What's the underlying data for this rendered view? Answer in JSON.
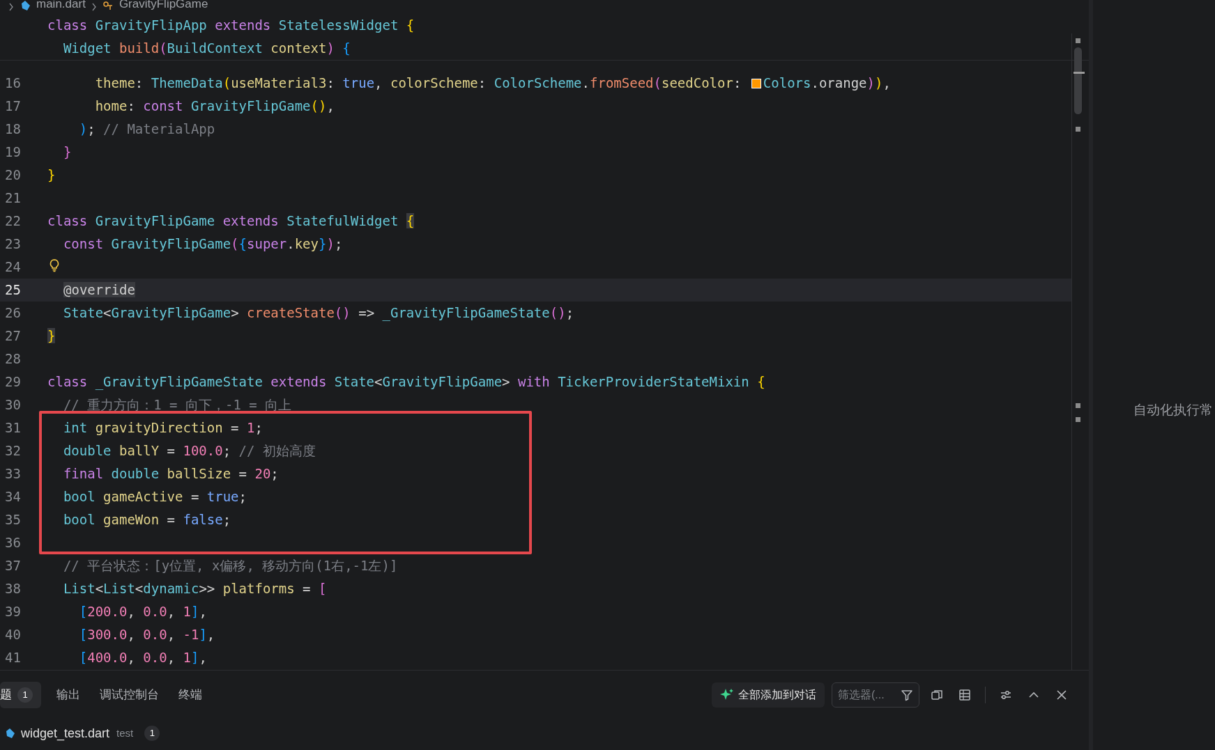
{
  "breadcrumb": [
    {
      "kind": "file",
      "label": "main.dart"
    },
    {
      "kind": "class",
      "label": "GravityFlipGame"
    }
  ],
  "sticky_lines": [
    {
      "tokens": [
        {
          "kind": "kw",
          "text": "class "
        },
        {
          "kind": "cls",
          "text": "GravityFlipApp "
        },
        {
          "kind": "kw",
          "text": "extends "
        },
        {
          "kind": "cls",
          "text": "StatelessWidget "
        },
        {
          "kind": "b1",
          "text": "{"
        }
      ]
    },
    {
      "tokens": [
        {
          "kind": "cls",
          "text": "  Widget "
        },
        {
          "kind": "fn",
          "text": "build"
        },
        {
          "kind": "b2",
          "text": "("
        },
        {
          "kind": "cls",
          "text": "BuildContext "
        },
        {
          "kind": "prop",
          "text": "context"
        },
        {
          "kind": "b2",
          "text": ") "
        },
        {
          "kind": "b3",
          "text": "{"
        }
      ]
    }
  ],
  "lines": [
    {
      "number": "16",
      "tokens": [
        {
          "kind": "prop",
          "text": "      theme"
        },
        {
          "kind": "pl",
          "text": ": "
        },
        {
          "kind": "cls",
          "text": "ThemeData"
        },
        {
          "kind": "b1",
          "text": "("
        },
        {
          "kind": "prop",
          "text": "useMaterial3"
        },
        {
          "kind": "pl",
          "text": ": "
        },
        {
          "kind": "lit",
          "text": "true"
        },
        {
          "kind": "pl",
          "text": ", "
        },
        {
          "kind": "prop",
          "text": "colorScheme"
        },
        {
          "kind": "pl",
          "text": ": "
        },
        {
          "kind": "cls",
          "text": "ColorScheme"
        },
        {
          "kind": "pl",
          "text": "."
        },
        {
          "kind": "fn",
          "text": "fromSeed"
        },
        {
          "kind": "b2",
          "text": "("
        },
        {
          "kind": "prop",
          "text": "seedColor"
        },
        {
          "kind": "pl",
          "text": ": "
        },
        {
          "kind": "swatch",
          "color": "#ff9800"
        },
        {
          "kind": "cls",
          "text": "Colors"
        },
        {
          "kind": "pl",
          "text": ".orange"
        },
        {
          "kind": "b2",
          "text": ")"
        },
        {
          "kind": "b1",
          "text": ")"
        },
        {
          "kind": "pl",
          "text": ","
        }
      ]
    },
    {
      "number": "17",
      "tokens": [
        {
          "kind": "prop",
          "text": "      home"
        },
        {
          "kind": "pl",
          "text": ": "
        },
        {
          "kind": "kw",
          "text": "const "
        },
        {
          "kind": "cls",
          "text": "GravityFlipGame"
        },
        {
          "kind": "b1",
          "text": "()"
        },
        {
          "kind": "pl",
          "text": ","
        }
      ]
    },
    {
      "number": "18",
      "tokens": [
        {
          "kind": "b3",
          "text": "    )"
        },
        {
          "kind": "pl",
          "text": "; "
        },
        {
          "kind": "cm",
          "text": "// MaterialApp"
        }
      ]
    },
    {
      "number": "19",
      "tokens": [
        {
          "kind": "b2",
          "text": "  }"
        }
      ]
    },
    {
      "number": "20",
      "tokens": [
        {
          "kind": "b1",
          "text": "}"
        }
      ]
    },
    {
      "number": "21"
    },
    {
      "number": "22",
      "tokens": [
        {
          "kind": "kw",
          "text": "class "
        },
        {
          "kind": "cls",
          "text": "GravityFlipGame "
        },
        {
          "kind": "kw",
          "text": "extends "
        },
        {
          "kind": "cls",
          "text": "StatefulWidget "
        },
        {
          "kind": "b1",
          "text": "{",
          "highlight": true
        }
      ]
    },
    {
      "number": "23",
      "tokens": [
        {
          "kind": "kw",
          "text": "  const "
        },
        {
          "kind": "cls",
          "text": "GravityFlipGame"
        },
        {
          "kind": "b2",
          "text": "("
        },
        {
          "kind": "b3",
          "text": "{"
        },
        {
          "kind": "kw",
          "text": "super"
        },
        {
          "kind": "pl",
          "text": "."
        },
        {
          "kind": "prop",
          "text": "key"
        },
        {
          "kind": "b3",
          "text": "}"
        },
        {
          "kind": "b2",
          "text": ")"
        },
        {
          "kind": "pl",
          "text": ";"
        }
      ]
    },
    {
      "number": "24",
      "tokens": [
        {
          "kind": "bulb"
        }
      ]
    },
    {
      "number": "25",
      "current": true,
      "tokens": [
        {
          "kind": "anno",
          "text": "@override",
          "highlight": true,
          "indent": true
        }
      ]
    },
    {
      "number": "26",
      "tokens": [
        {
          "kind": "cls",
          "text": "  State"
        },
        {
          "kind": "pl",
          "text": "<"
        },
        {
          "kind": "cls",
          "text": "GravityFlipGame"
        },
        {
          "kind": "pl",
          "text": "> "
        },
        {
          "kind": "fn",
          "text": "createState"
        },
        {
          "kind": "b2",
          "text": "()"
        },
        {
          "kind": "pl",
          "text": " => "
        },
        {
          "kind": "cls",
          "text": "_GravityFlipGameState"
        },
        {
          "kind": "b2",
          "text": "()"
        },
        {
          "kind": "pl",
          "text": ";"
        }
      ]
    },
    {
      "number": "27",
      "tokens": [
        {
          "kind": "b1",
          "text": "}",
          "highlight": true
        }
      ]
    },
    {
      "number": "28"
    },
    {
      "number": "29",
      "tokens": [
        {
          "kind": "kw",
          "text": "class "
        },
        {
          "kind": "cls",
          "text": "_GravityFlipGameState "
        },
        {
          "kind": "kw",
          "text": "extends "
        },
        {
          "kind": "cls",
          "text": "State"
        },
        {
          "kind": "pl",
          "text": "<"
        },
        {
          "kind": "cls",
          "text": "GravityFlipGame"
        },
        {
          "kind": "pl",
          "text": "> "
        },
        {
          "kind": "kw",
          "text": "with "
        },
        {
          "kind": "cls",
          "text": "TickerProviderStateMixin "
        },
        {
          "kind": "b1",
          "text": "{"
        }
      ]
    },
    {
      "number": "30",
      "tokens": [
        {
          "kind": "cm",
          "text": "  // 重力方向：1 = 向下，-1 = 向上"
        }
      ]
    },
    {
      "number": "31",
      "tokens": [
        {
          "kind": "cls",
          "text": "  int "
        },
        {
          "kind": "prop",
          "text": "gravityDirection"
        },
        {
          "kind": "pl",
          "text": " = "
        },
        {
          "kind": "num",
          "text": "1"
        },
        {
          "kind": "pl",
          "text": ";"
        }
      ]
    },
    {
      "number": "32",
      "tokens": [
        {
          "kind": "cls",
          "text": "  double "
        },
        {
          "kind": "prop",
          "text": "ballY"
        },
        {
          "kind": "pl",
          "text": " = "
        },
        {
          "kind": "num",
          "text": "100.0"
        },
        {
          "kind": "pl",
          "text": "; "
        },
        {
          "kind": "cm",
          "text": "// 初始高度"
        }
      ]
    },
    {
      "number": "33",
      "tokens": [
        {
          "kind": "kw",
          "text": "  final "
        },
        {
          "kind": "cls",
          "text": "double "
        },
        {
          "kind": "prop",
          "text": "ballSize"
        },
        {
          "kind": "pl",
          "text": " = "
        },
        {
          "kind": "num",
          "text": "20"
        },
        {
          "kind": "pl",
          "text": ";"
        }
      ]
    },
    {
      "number": "34",
      "tokens": [
        {
          "kind": "cls",
          "text": "  bool "
        },
        {
          "kind": "prop",
          "text": "gameActive"
        },
        {
          "kind": "pl",
          "text": " = "
        },
        {
          "kind": "lit",
          "text": "true"
        },
        {
          "kind": "pl",
          "text": ";"
        }
      ]
    },
    {
      "number": "35",
      "tokens": [
        {
          "kind": "cls",
          "text": "  bool "
        },
        {
          "kind": "prop",
          "text": "gameWon"
        },
        {
          "kind": "pl",
          "text": " = "
        },
        {
          "kind": "lit",
          "text": "false"
        },
        {
          "kind": "pl",
          "text": ";"
        }
      ]
    },
    {
      "number": "36"
    },
    {
      "number": "37",
      "tokens": [
        {
          "kind": "cm",
          "text": "  // 平台状态：[y位置, x偏移, 移动方向(1右,-1左)]"
        }
      ]
    },
    {
      "number": "38",
      "tokens": [
        {
          "kind": "cls",
          "text": "  List"
        },
        {
          "kind": "pl",
          "text": "<"
        },
        {
          "kind": "cls",
          "text": "List"
        },
        {
          "kind": "pl",
          "text": "<"
        },
        {
          "kind": "cls",
          "text": "dynamic"
        },
        {
          "kind": "pl",
          "text": ">> "
        },
        {
          "kind": "prop",
          "text": "platforms"
        },
        {
          "kind": "pl",
          "text": " = "
        },
        {
          "kind": "b2",
          "text": "["
        }
      ]
    },
    {
      "number": "39",
      "tokens": [
        {
          "kind": "b3",
          "text": "    ["
        },
        {
          "kind": "num",
          "text": "200.0"
        },
        {
          "kind": "pl",
          "text": ", "
        },
        {
          "kind": "num",
          "text": "0.0"
        },
        {
          "kind": "pl",
          "text": ", "
        },
        {
          "kind": "num",
          "text": "1"
        },
        {
          "kind": "b3",
          "text": "]"
        },
        {
          "kind": "pl",
          "text": ","
        }
      ]
    },
    {
      "number": "40",
      "tokens": [
        {
          "kind": "b3",
          "text": "    ["
        },
        {
          "kind": "num",
          "text": "300.0"
        },
        {
          "kind": "pl",
          "text": ", "
        },
        {
          "kind": "num",
          "text": "0.0"
        },
        {
          "kind": "pl",
          "text": ", "
        },
        {
          "kind": "num",
          "text": "-1"
        },
        {
          "kind": "b3",
          "text": "]"
        },
        {
          "kind": "pl",
          "text": ","
        }
      ]
    },
    {
      "number": "41",
      "tokens": [
        {
          "kind": "b3",
          "text": "    ["
        },
        {
          "kind": "num",
          "text": "400.0"
        },
        {
          "kind": "pl",
          "text": ", "
        },
        {
          "kind": "num",
          "text": "0.0"
        },
        {
          "kind": "pl",
          "text": ", "
        },
        {
          "kind": "num",
          "text": "1"
        },
        {
          "kind": "b3",
          "text": "]"
        },
        {
          "kind": "pl",
          "text": ","
        }
      ]
    }
  ],
  "side_panel": {
    "text": "自动化执行常"
  },
  "panel": {
    "tabs": [
      {
        "label": "题",
        "badge": "1",
        "selected": true
      },
      {
        "label": "输出",
        "selected": false
      },
      {
        "label": "调试控制台",
        "selected": false
      },
      {
        "label": "终端",
        "selected": false
      }
    ],
    "add_button": "全部添加到对话",
    "filter": {
      "placeholder": "筛选器(..."
    },
    "items": [
      {
        "file": "widget_test.dart",
        "folder": "test",
        "count": "1"
      }
    ]
  }
}
